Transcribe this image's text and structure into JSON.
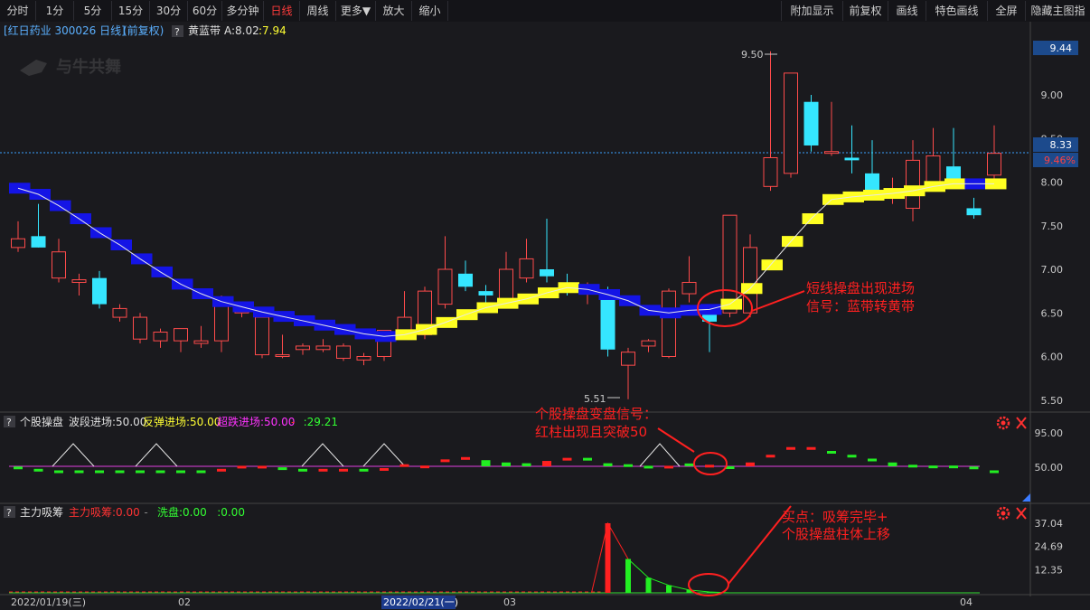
{
  "toolbar": {
    "left": [
      "分时",
      "1分",
      "5分",
      "15分",
      "30分",
      "60分",
      "多分钟",
      "日线",
      "周线",
      "更多▼",
      "放大",
      "缩小"
    ],
    "active": "日线",
    "right": [
      "附加显示",
      "前复权",
      "画线",
      "特色画线",
      "全屏",
      "隐藏主图指标"
    ]
  },
  "main": {
    "title": "[红日药业 300026 日线]",
    "adjust": "(前复权)",
    "help": "?",
    "indicator_name": "黄蓝带",
    "a_label": "A:8.02",
    "a2_label": ":7.94",
    "watermark": "与牛共舞",
    "high_label": "9.50",
    "low_label": "5.51",
    "y_ticks": [
      "9.00",
      "8.50",
      "8.00",
      "7.50",
      "7.00",
      "6.50",
      "6.00",
      "5.50"
    ],
    "top_badge": "9.44",
    "price_badge": "8.33",
    "pct_badge": "9.46%",
    "annotation": [
      "短线操盘出现进场",
      "信号：蓝带转黄带"
    ]
  },
  "panel2": {
    "help": "?",
    "name": "个股操盘",
    "items": [
      {
        "text": "波段进场:50.00",
        "color": "#e0e0e0"
      },
      {
        "text": "反弹进场:50.00",
        "color": "#ffff33"
      },
      {
        "text": "超跌进场:50.00",
        "color": "#ff33ff"
      },
      {
        "text": "-",
        "color": "#ff3333"
      },
      {
        "text": ":29.21",
        "color": "#33ff33"
      }
    ],
    "y_ticks": [
      "95.00",
      "50.00"
    ],
    "annotation": [
      "个股操盘变盘信号：",
      "红柱出现且突破50"
    ]
  },
  "panel3": {
    "help": "?",
    "name": "主力吸筹",
    "items": [
      {
        "text": "主力吸筹:0.00",
        "color": "#ff3333"
      },
      {
        "text": "-",
        "color": "#888888"
      },
      {
        "text": "洗盘:0.00",
        "color": "#33ff33"
      },
      {
        "text": ":0.00",
        "color": "#33ff33"
      }
    ],
    "y_ticks": [
      "37.04",
      "24.69",
      "12.35"
    ],
    "annotation": [
      "买点：吸筹完毕+",
      "个股操盘柱体上移"
    ]
  },
  "xaxis": {
    "labels": [
      "2022/01/19(三)",
      "02",
      "2022/02/21(一)",
      "03",
      "04"
    ]
  },
  "chart_data": {
    "type": "candlestick",
    "symbol": "红日药业 300026",
    "ylim": [
      5.3,
      9.6
    ],
    "candles": [
      {
        "o": 7.25,
        "h": 7.55,
        "l": 7.2,
        "c": 7.35,
        "band": "blue",
        "bv": 7.93
      },
      {
        "o": 7.38,
        "h": 7.75,
        "l": 7.25,
        "c": 7.25,
        "band": "blue",
        "bv": 7.86
      },
      {
        "o": 6.9,
        "h": 7.35,
        "l": 6.85,
        "c": 7.2,
        "band": "blue",
        "bv": 7.73
      },
      {
        "o": 6.85,
        "h": 6.95,
        "l": 6.7,
        "c": 6.88,
        "band": "blue",
        "bv": 7.58
      },
      {
        "o": 6.9,
        "h": 6.98,
        "l": 6.55,
        "c": 6.6,
        "band": "blue",
        "bv": 7.42
      },
      {
        "o": 6.45,
        "h": 6.6,
        "l": 6.4,
        "c": 6.55,
        "band": "blue",
        "bv": 7.28
      },
      {
        "o": 6.2,
        "h": 6.5,
        "l": 6.15,
        "c": 6.45,
        "band": "blue",
        "bv": 7.12
      },
      {
        "o": 6.18,
        "h": 6.32,
        "l": 6.1,
        "c": 6.28,
        "band": "blue",
        "bv": 6.97
      },
      {
        "o": 6.18,
        "h": 6.3,
        "l": 6.05,
        "c": 6.32,
        "band": "blue",
        "bv": 6.83
      },
      {
        "o": 6.15,
        "h": 6.35,
        "l": 6.1,
        "c": 6.18,
        "band": "blue",
        "bv": 6.72
      },
      {
        "o": 6.18,
        "h": 6.7,
        "l": 6.05,
        "c": 6.65,
        "band": "blue",
        "bv": 6.63
      },
      {
        "o": 6.5,
        "h": 6.6,
        "l": 6.45,
        "c": 6.52,
        "band": "blue",
        "bv": 6.57
      },
      {
        "o": 6.02,
        "h": 6.45,
        "l": 5.98,
        "c": 6.45,
        "band": "blue",
        "bv": 6.51
      },
      {
        "o": 6.0,
        "h": 6.25,
        "l": 5.98,
        "c": 6.02,
        "band": "blue",
        "bv": 6.46
      },
      {
        "o": 6.08,
        "h": 6.15,
        "l": 6.02,
        "c": 6.12,
        "band": "blue",
        "bv": 6.41
      },
      {
        "o": 6.08,
        "h": 6.2,
        "l": 6.05,
        "c": 6.12,
        "band": "blue",
        "bv": 6.36
      },
      {
        "o": 5.98,
        "h": 6.15,
        "l": 5.95,
        "c": 6.12,
        "band": "blue",
        "bv": 6.31
      },
      {
        "o": 5.96,
        "h": 6.04,
        "l": 5.9,
        "c": 6.0,
        "band": "blue",
        "bv": 6.26
      },
      {
        "o": 6.0,
        "h": 6.3,
        "l": 5.95,
        "c": 6.3,
        "band": "blue",
        "bv": 6.23
      },
      {
        "o": 6.25,
        "h": 6.75,
        "l": 6.2,
        "c": 6.45,
        "band": "yellow",
        "bv": 6.25
      },
      {
        "o": 6.25,
        "h": 6.8,
        "l": 6.2,
        "c": 6.75,
        "band": "yellow",
        "bv": 6.31
      },
      {
        "o": 6.6,
        "h": 7.38,
        "l": 6.55,
        "c": 7.0,
        "band": "yellow",
        "bv": 6.39
      },
      {
        "o": 6.95,
        "h": 7.1,
        "l": 6.75,
        "c": 6.8,
        "band": "yellow",
        "bv": 6.48
      },
      {
        "o": 6.75,
        "h": 6.82,
        "l": 6.55,
        "c": 6.7,
        "band": "yellow",
        "bv": 6.56
      },
      {
        "o": 6.65,
        "h": 7.2,
        "l": 6.55,
        "c": 7.0,
        "band": "yellow",
        "bv": 6.61
      },
      {
        "o": 6.9,
        "h": 7.35,
        "l": 6.85,
        "c": 7.12,
        "band": "yellow",
        "bv": 6.66
      },
      {
        "o": 7.0,
        "h": 7.58,
        "l": 6.85,
        "c": 6.92,
        "band": "yellow",
        "bv": 6.73
      },
      {
        "o": 6.85,
        "h": 6.95,
        "l": 6.7,
        "c": 6.8,
        "band": "yellow",
        "bv": 6.79
      },
      {
        "o": 6.8,
        "h": 6.85,
        "l": 6.6,
        "c": 6.8,
        "band": "blue",
        "bv": 6.77
      },
      {
        "o": 6.75,
        "h": 6.8,
        "l": 6.0,
        "c": 6.08,
        "band": "blue",
        "bv": 6.71
      },
      {
        "o": 5.9,
        "h": 6.1,
        "l": 5.51,
        "c": 6.05,
        "band": "blue",
        "bv": 6.64
      },
      {
        "o": 6.12,
        "h": 6.2,
        "l": 6.05,
        "c": 6.18,
        "band": "blue",
        "bv": 6.53
      },
      {
        "o": 6.0,
        "h": 6.78,
        "l": 5.98,
        "c": 6.75,
        "band": "blue",
        "bv": 6.5
      },
      {
        "o": 6.72,
        "h": 7.15,
        "l": 6.62,
        "c": 6.85,
        "band": "blue",
        "bv": 6.53
      },
      {
        "o": 6.52,
        "h": 6.6,
        "l": 6.05,
        "c": 6.4,
        "band": "blue",
        "bv": 6.54
      },
      {
        "o": 6.5,
        "h": 7.62,
        "l": 6.45,
        "c": 7.62,
        "band": "yellow",
        "bv": 6.6
      },
      {
        "o": 6.5,
        "h": 7.4,
        "l": 6.45,
        "c": 7.25,
        "band": "yellow",
        "bv": 6.78
      },
      {
        "o": 7.95,
        "h": 9.5,
        "l": 7.9,
        "c": 8.28,
        "band": "yellow",
        "bv": 7.05
      },
      {
        "o": 8.1,
        "h": 9.25,
        "l": 8.05,
        "c": 9.25,
        "band": "yellow",
        "bv": 7.32
      },
      {
        "o": 8.92,
        "h": 9.0,
        "l": 8.35,
        "c": 8.42,
        "band": "yellow",
        "bv": 7.58
      },
      {
        "o": 8.33,
        "h": 8.92,
        "l": 8.3,
        "c": 8.35,
        "band": "yellow",
        "bv": 7.8
      },
      {
        "o": 8.28,
        "h": 8.65,
        "l": 8.1,
        "c": 8.25,
        "band": "yellow",
        "bv": 7.83
      },
      {
        "o": 8.1,
        "h": 8.48,
        "l": 7.85,
        "c": 7.85,
        "band": "yellow",
        "bv": 7.85
      },
      {
        "o": 7.85,
        "h": 8.05,
        "l": 7.75,
        "c": 7.85,
        "band": "yellow",
        "bv": 7.87
      },
      {
        "o": 7.7,
        "h": 8.48,
        "l": 7.55,
        "c": 8.25,
        "band": "yellow",
        "bv": 7.9
      },
      {
        "o": 7.95,
        "h": 8.62,
        "l": 7.9,
        "c": 8.3,
        "band": "yellow",
        "bv": 7.95
      },
      {
        "o": 8.18,
        "h": 8.62,
        "l": 7.95,
        "c": 7.95,
        "band": "yellow",
        "bv": 7.98
      },
      {
        "o": 7.7,
        "h": 7.82,
        "l": 7.58,
        "c": 7.62,
        "band": "blue",
        "bv": 7.98
      },
      {
        "o": 8.08,
        "h": 8.65,
        "l": 8.0,
        "c": 8.33,
        "band": "yellow",
        "bv": 7.98
      }
    ],
    "panel2_bars": [
      {
        "v": 45,
        "c": "g"
      },
      {
        "v": 42,
        "c": "g"
      },
      {
        "v": 40,
        "c": "g"
      },
      {
        "v": 40,
        "c": "g"
      },
      {
        "v": 40,
        "c": "g"
      },
      {
        "v": 40,
        "c": "g"
      },
      {
        "v": 40,
        "c": "g"
      },
      {
        "v": 40,
        "c": "g"
      },
      {
        "v": 40,
        "c": "g"
      },
      {
        "v": 40,
        "c": "g"
      },
      {
        "v": 42,
        "c": "r"
      },
      {
        "v": 46,
        "c": "r"
      },
      {
        "v": 46,
        "c": "r"
      },
      {
        "v": 44,
        "c": "g"
      },
      {
        "v": 42,
        "c": "g"
      },
      {
        "v": 42,
        "c": "r"
      },
      {
        "v": 42,
        "c": "r"
      },
      {
        "v": 42,
        "c": "g"
      },
      {
        "v": 43,
        "c": "r"
      },
      {
        "v": 48,
        "c": "r"
      },
      {
        "v": 51,
        "c": "r"
      },
      {
        "v": 59,
        "c": "r"
      },
      {
        "v": 62,
        "c": "r"
      },
      {
        "v": 58,
        "c": "g"
      },
      {
        "v": 55,
        "c": "g"
      },
      {
        "v": 54,
        "c": "g"
      },
      {
        "v": 57,
        "c": "r"
      },
      {
        "v": 61,
        "c": "r"
      },
      {
        "v": 61,
        "c": "g"
      },
      {
        "v": 54,
        "c": "g"
      },
      {
        "v": 48,
        "c": "g"
      },
      {
        "v": 46,
        "c": "g"
      },
      {
        "v": 46,
        "c": "r"
      },
      {
        "v": 49,
        "c": "g"
      },
      {
        "v": 52,
        "c": "r"
      },
      {
        "v": 50,
        "c": "g"
      },
      {
        "v": 55,
        "c": "r"
      },
      {
        "v": 65,
        "c": "r"
      },
      {
        "v": 75,
        "c": "r"
      },
      {
        "v": 75,
        "c": "r"
      },
      {
        "v": 70,
        "c": "g"
      },
      {
        "v": 65,
        "c": "g"
      },
      {
        "v": 60,
        "c": "g"
      },
      {
        "v": 55,
        "c": "g"
      },
      {
        "v": 52,
        "c": "g"
      },
      {
        "v": 51,
        "c": "g"
      },
      {
        "v": 51,
        "c": "g"
      },
      {
        "v": 45,
        "c": "g"
      },
      {
        "v": 40,
        "c": "g"
      }
    ],
    "panel3": {
      "absorb": [
        {
          "i": 29,
          "v": 37.04
        },
        {
          "i": 30,
          "v": 18
        }
      ],
      "wash": [
        {
          "i": 30,
          "v": 18
        },
        {
          "i": 31,
          "v": 8
        },
        {
          "i": 32,
          "v": 4
        },
        {
          "i": 33,
          "v": 1.5
        },
        {
          "i": 34,
          "v": 0.5
        }
      ]
    }
  }
}
